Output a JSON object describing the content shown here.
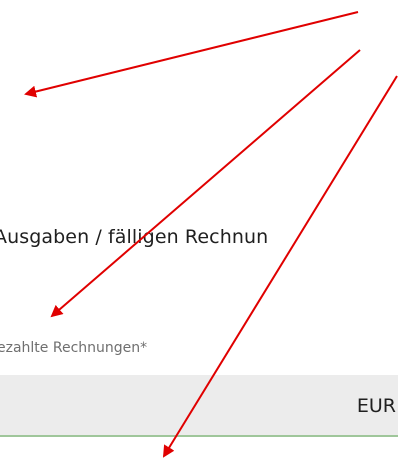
{
  "section": {
    "heading": "Ausgaben / fälligen Rechnun"
  },
  "field": {
    "label": "ezahlte Rechnungen*",
    "currency": "EUR",
    "value": ""
  },
  "annotation": {
    "arrow_color": "#e00000"
  }
}
